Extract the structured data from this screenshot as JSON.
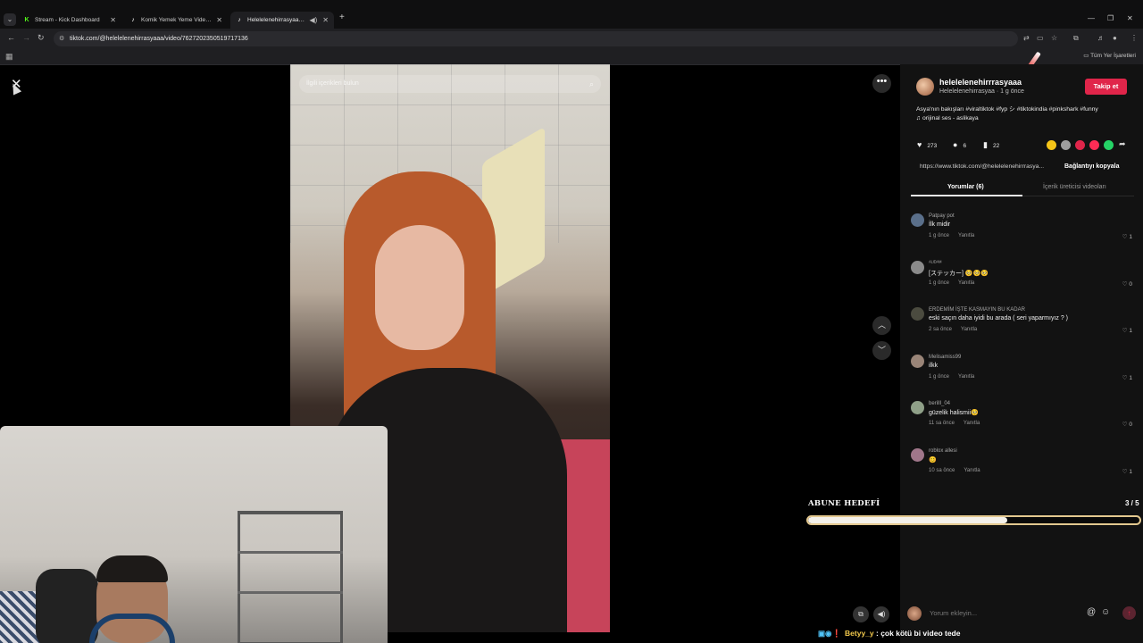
{
  "browser": {
    "tabs": [
      {
        "title": "Stream - Kick Dashboard",
        "favicon": "kick-icon",
        "fav_color": "#53fc18",
        "fav_char": "K",
        "active": false
      },
      {
        "title": "Komik Yemek Yeme Videoları |",
        "favicon": "tiktok-icon",
        "fav_color": "#ffffff",
        "fav_char": "♪",
        "active": false
      },
      {
        "title": "Helelelenehirrasyaa (@helel",
        "favicon": "tiktok-icon",
        "fav_color": "#ffffff",
        "fav_char": "♪",
        "active": true
      }
    ],
    "url": "tiktok.com/@helelelenehirrasyaaa/video/7627202350519717136",
    "bookmarks_all_label": "Tüm Yer İşaretleri"
  },
  "video": {
    "search_placeholder": "İlgili içerikleri bulun"
  },
  "author": {
    "username": "helelelenehirrrasyaaa",
    "subline": "Helelelenehirrasyaa · 1 g önce",
    "follow_label": "Takip et",
    "caption": "Asya'nın bakışları #viraltiktok #fyp シ #tiktokindia #pinkshark #funny",
    "sound": "♫  orijinal ses - aslikaya"
  },
  "stats": {
    "likes": "273",
    "comments": "6",
    "saves": "22"
  },
  "share_colors": [
    "#f5c518",
    "#9e9e9e",
    "#e0254a",
    "#fe2c55",
    "#25d366",
    "#1877f2"
  ],
  "link": {
    "url": "https://www.tiktok.com/@helelelenehirrrasya...",
    "copy_label": "Bağlantıyı kopyala"
  },
  "panel_tabs": {
    "comments": "Yorumlar (6)",
    "creator_videos": "İçerik üreticisi videoları"
  },
  "comments": [
    {
      "user": "Patpay pot",
      "text": "İlk midir",
      "time": "1 g önce",
      "reply": "Yanıtla",
      "likes": "1",
      "av_color": "#5a6f8a"
    },
    {
      "user": "ᴬᴸᴵᴰᴬᴹ",
      "text": "[ステッカー] 🥺🥺🥺",
      "time": "1 g önce",
      "reply": "Yanıtla",
      "likes": "0",
      "av_color": "#8a8a8a"
    },
    {
      "user": "ERDEMİM İŞTE KASMAYIN BU KADAR",
      "text": "eski saçın daha iyidi bu arada ( seri yaparmıyız ? )",
      "time": "2 sa önce",
      "reply": "Yanıtla",
      "likes": "1",
      "av_color": "#4b4b3f"
    },
    {
      "user": "Melisamiss99",
      "text": "ilkk",
      "time": "1 g önce",
      "reply": "Yanıtla",
      "likes": "1",
      "av_color": "#9a8578"
    },
    {
      "user": "berilll_04",
      "text": "güzelik halismii🥺",
      "time": "11 sa önce",
      "reply": "Yanıtla",
      "likes": "0",
      "av_color": "#8fa088"
    },
    {
      "user": "roblox allesi",
      "text": "😊",
      "time": "10 sa önce",
      "reply": "Yanıtla",
      "likes": "1",
      "av_color": "#a0768a"
    }
  ],
  "comment_input": {
    "placeholder": "Yorum ekleyin..."
  },
  "sub_goal": {
    "title": "ABUNE HEDEFİ",
    "count": "3 / 5",
    "progress": 0.6
  },
  "chat": {
    "user": "Betyy_y",
    "message": ": çok kötü bi video tede"
  }
}
